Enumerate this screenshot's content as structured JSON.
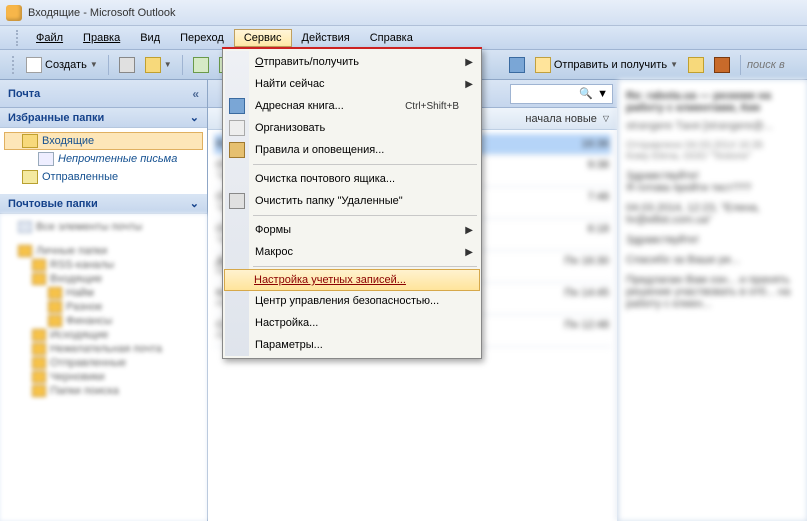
{
  "window": {
    "title": "Входящие - Microsoft Outlook"
  },
  "menubar": {
    "file": "Файл",
    "edit": "Правка",
    "view": "Вид",
    "go": "Переход",
    "service": "Сервис",
    "actions": "Действия",
    "help": "Справка"
  },
  "toolbar": {
    "create": "Создать",
    "send_receive": "Отправить и получить",
    "search_placeholder": "поиск в"
  },
  "left": {
    "mail_header": "Почта",
    "fav_header": "Избранные папки",
    "inbox": "Входящие",
    "unread": "Непрочтенные письма",
    "sent": "Отправленные",
    "folders_header": "Почтовые папки"
  },
  "list": {
    "sort_label": "начала новые"
  },
  "dropdown": {
    "send_recv": "Отправить/получить",
    "find_now": "Найти сейчас",
    "address_book": "Адресная книга...",
    "address_book_sc": "Ctrl+Shift+B",
    "organize": "Организовать",
    "rules": "Правила и оповещения...",
    "cleanup": "Очистка почтового ящика...",
    "empty_trash": "Очистить папку \"Удаленные\"",
    "forms": "Формы",
    "macros": "Макрос",
    "accounts": "Настройка учетных записей...",
    "trust_center": "Центр управления безопасностью...",
    "customize": "Настройка...",
    "options": "Параметры..."
  }
}
